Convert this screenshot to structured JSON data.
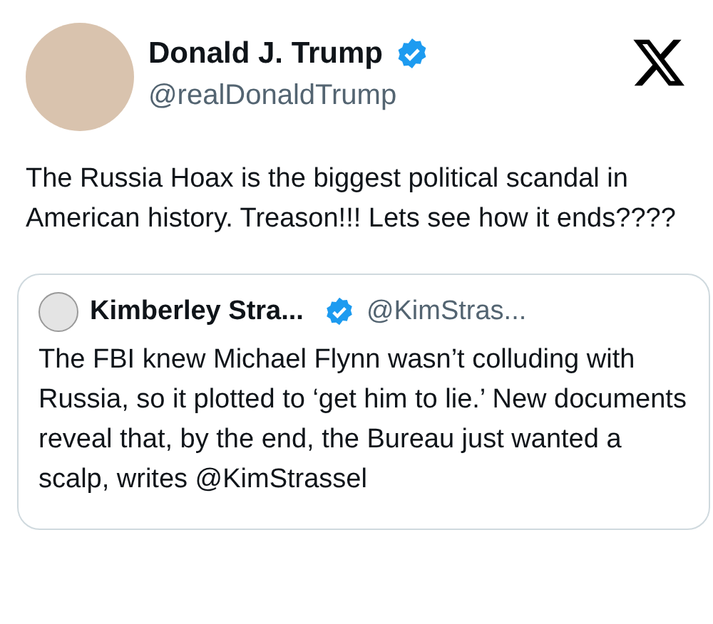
{
  "author": {
    "name": "Donald J. Trump",
    "verified": true,
    "handle": "@realDonaldTrump"
  },
  "text": "The Russia Hoax is the biggest political scandal in American history. Treason!!! Lets see how it ends????",
  "quoted": {
    "author": {
      "name": "Kimberley Stra...",
      "verified": true,
      "handle": "@KimStras..."
    },
    "text": "The FBI knew Michael Flynn wasn’t colluding with Russia, so it plotted to ‘get him to lie.’ New documents reveal that, by the end, the Bureau just wanted a scalp, writes @KimStrassel"
  }
}
